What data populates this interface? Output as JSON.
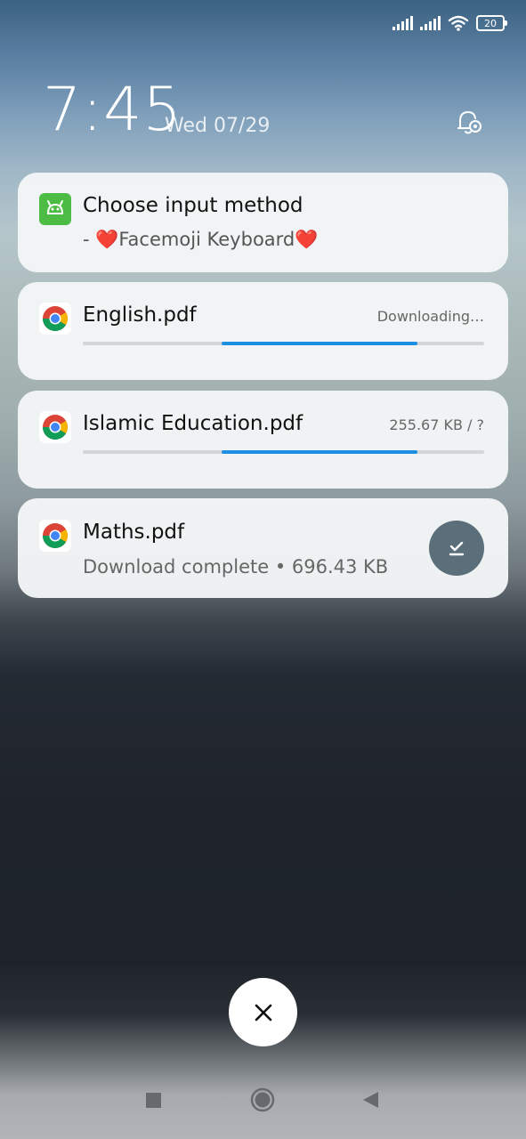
{
  "status_bar": {
    "battery_level": "20"
  },
  "lockscreen": {
    "time": "7:45",
    "date": "Wed 07/29"
  },
  "notifications": [
    {
      "app_icon": "android-keyboard-icon",
      "title": "Choose input method",
      "subtitle": " - ❤️Facemoji Keyboard❤️"
    },
    {
      "app_icon": "chrome-icon",
      "title": "English.pdf",
      "status": "Downloading…",
      "progress_indeterminate": true
    },
    {
      "app_icon": "chrome-icon",
      "title": "Islamic Education.pdf",
      "status": "255.67 KB / ?",
      "progress_indeterminate": true
    },
    {
      "app_icon": "chrome-icon",
      "title": "Maths.pdf",
      "subtitle": "Download complete • 696.43 KB",
      "action_icon": "download-done-icon"
    }
  ],
  "controls": {
    "clear_all_icon": "close-icon"
  },
  "nav_bar": {
    "recents_icon": "square-icon",
    "home_icon": "circle-icon",
    "back_icon": "triangle-back-icon"
  },
  "colors": {
    "progress": "#1c8fe3",
    "download_button": "#5b6f7a",
    "keyboard_icon": "#4cbc45"
  }
}
